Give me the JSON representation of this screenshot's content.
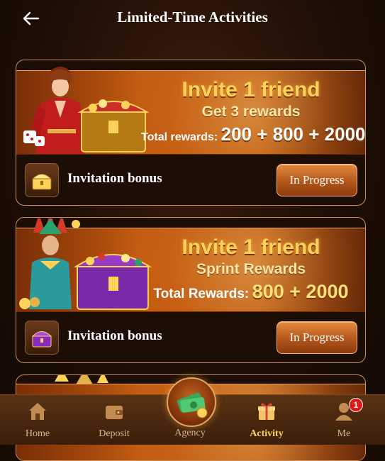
{
  "header": {
    "title": "Limited-Time Activities",
    "back_icon": "arrow-left-icon"
  },
  "activities": [
    {
      "banner": {
        "headline": "Invite 1 friend",
        "subline": "Get 3 rewards",
        "total_label": "Total rewards:",
        "total_value": "200 + 800 + 2000"
      },
      "bonus_label": "Invitation bonus",
      "bonus_icon": "gold-chest-icon",
      "button_label": "In Progress"
    },
    {
      "banner": {
        "headline": "Invite 1 friend",
        "subline": "Sprint Rewards",
        "total_label": "Total Rewards:",
        "total_value": "800 + 2000"
      },
      "bonus_label": "Invitation bonus",
      "bonus_icon": "purple-chest-icon",
      "button_label": "In Progress"
    }
  ],
  "nav": {
    "items": [
      {
        "label": "Home",
        "icon": "home-icon"
      },
      {
        "label": "Deposit",
        "icon": "wallet-icon"
      },
      {
        "label": "Agency",
        "icon": "money-icon"
      },
      {
        "label": "Activity",
        "icon": "gift-icon",
        "active": true
      },
      {
        "label": "Me",
        "icon": "user-icon",
        "badge": "1"
      }
    ]
  },
  "colors": {
    "accent": "#ffd25a",
    "button": "#c4621f",
    "border": "#c9935a",
    "badge": "#e01818"
  }
}
